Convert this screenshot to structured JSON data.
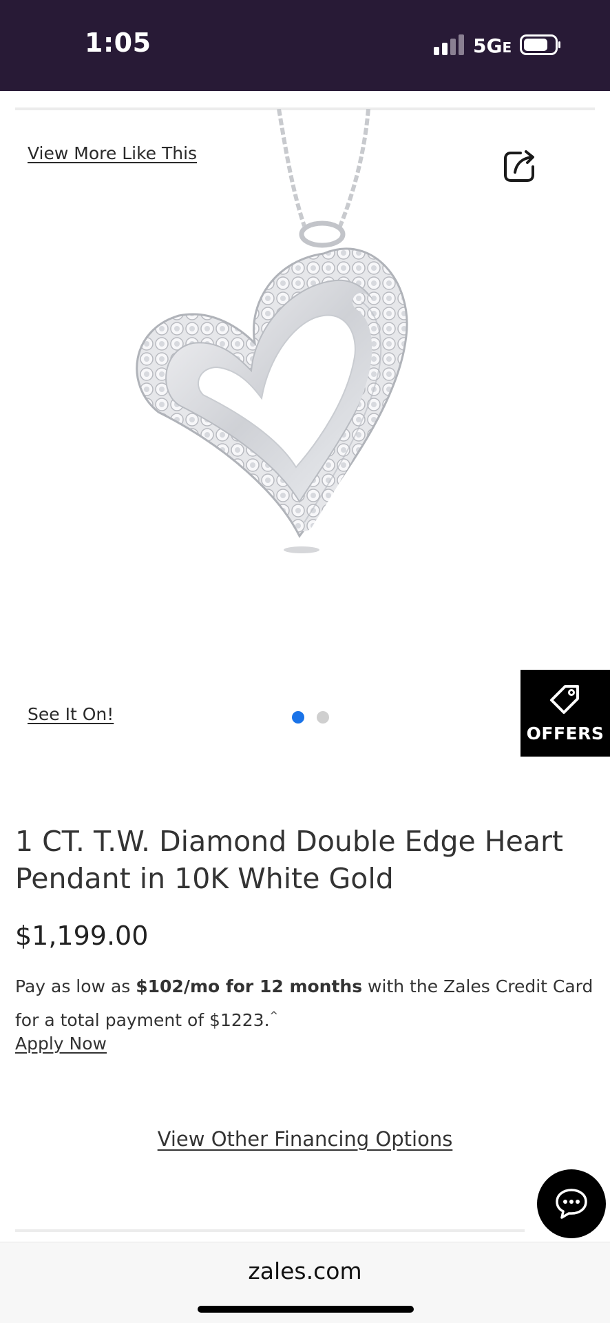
{
  "status_bar": {
    "time": "1:05",
    "network": "5G",
    "network_suffix": "E",
    "icons": [
      "signal-icon",
      "battery-icon"
    ]
  },
  "gallery": {
    "view_more_label": "View More Like This",
    "share_icon": "share-icon",
    "image_alt": "heart pendant",
    "see_it_on_label": "See It On!",
    "page_count": 2,
    "active_page": 1,
    "active_dot_color": "#1a73e8"
  },
  "offers": {
    "label": "OFFERS",
    "icon": "tag-icon"
  },
  "product": {
    "title": "1 CT. T.W. Diamond Double Edge Heart Pendant in 10K White Gold",
    "price": "$1,199.00"
  },
  "financing": {
    "text_prefix": "Pay as low as ",
    "text_bold": "$102/mo for 12 months",
    "text_suffix": " with the Zales Credit Card for a total payment of $1223.",
    "text_marker": "^",
    "apply_label": "Apply Now",
    "options_label": "View Other Financing Options"
  },
  "chat": {
    "icon": "chat-icon"
  },
  "browser": {
    "url": "zales.com"
  },
  "colors": {
    "status_bar_bg": "#281a36",
    "offers_bg": "#000000"
  }
}
